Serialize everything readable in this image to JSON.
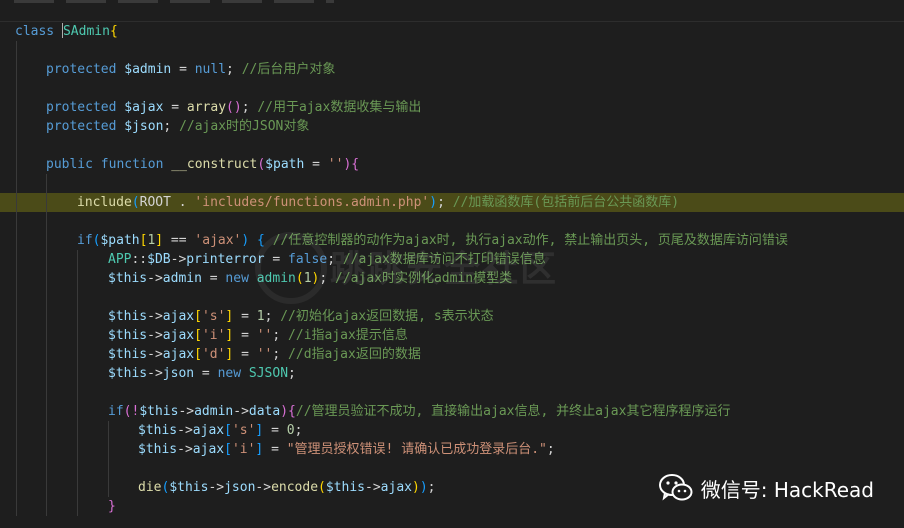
{
  "code": {
    "l1_class_kw": "class",
    "l1_class_name": "SAdmin",
    "l1_brace": "{",
    "l3_protected": "protected",
    "l3_var": "$admin",
    "l3_eq": " = ",
    "l3_null": "null",
    "l3_semi": ";",
    "l3_comment": "//后台用户对象",
    "l5_protected": "protected",
    "l5_var": "$ajax",
    "l5_eq": " = ",
    "l5_fn": "array",
    "l5_paren": "()",
    "l5_semi": ";",
    "l5_comment": "//用于ajax数据收集与输出",
    "l6_protected": "protected",
    "l6_var": "$json",
    "l6_semi": ";",
    "l6_comment": "//ajax时的JSON对象",
    "l8_public": "public",
    "l8_function": "function",
    "l8_name": "__construct",
    "l8_open": "(",
    "l8_var": "$path",
    "l8_eq": " = ",
    "l8_str": "''",
    "l8_close": ")",
    "l8_brace": "{",
    "l10_include": "include",
    "l10_open": "(",
    "l10_root": "ROOT",
    "l10_dot": " . ",
    "l10_str": "'includes/functions.admin.php'",
    "l10_close": ")",
    "l10_semi": ";",
    "l10_comment": "//加载函数库(包括前后台公共函数库)",
    "l12_if": "if",
    "l12_open": "(",
    "l12_var": "$path",
    "l12_idx_open": "[",
    "l12_idx": "1",
    "l12_idx_close": "]",
    "l12_eq": " == ",
    "l12_str": "'ajax'",
    "l12_close": ")",
    "l12_brace": "{",
    "l12_comment": "//任意控制器的动作为ajax时, 执行ajax动作, 禁止输出页头, 页尾及数据库访问错误",
    "l13_app": "APP",
    "l13_sep": "::",
    "l13_db": "$DB",
    "l13_arrow": "->",
    "l13_prop": "printerror",
    "l13_eq": " = ",
    "l13_false": "false",
    "l13_semi": ";",
    "l13_comment": "//ajax数据库访问不打印错误信息",
    "l14_this": "$this",
    "l14_arrow": "->",
    "l14_prop": "admin",
    "l14_eq": " = ",
    "l14_new": "new",
    "l14_cls": "admin",
    "l14_open": "(",
    "l14_num": "1",
    "l14_close": ")",
    "l14_semi": ";",
    "l14_comment": "//ajax时实例化admin模型类",
    "l16_this": "$this",
    "l16_arrow": "->",
    "l16_prop": "ajax",
    "l16_open": "[",
    "l16_key": "'s'",
    "l16_close": "]",
    "l16_eq": " = ",
    "l16_num": "1",
    "l16_semi": ";",
    "l16_comment": "//初始化ajax返回数据, s表示状态",
    "l17_this": "$this",
    "l17_arrow": "->",
    "l17_prop": "ajax",
    "l17_open": "[",
    "l17_key": "'i'",
    "l17_close": "]",
    "l17_eq": " = ",
    "l17_val": "''",
    "l17_semi": ";",
    "l17_comment": "//i指ajax提示信息",
    "l18_this": "$this",
    "l18_arrow": "->",
    "l18_prop": "ajax",
    "l18_open": "[",
    "l18_key": "'d'",
    "l18_close": "]",
    "l18_eq": " = ",
    "l18_val": "''",
    "l18_semi": ";",
    "l18_comment": "//d指ajax返回的数据",
    "l19_this": "$this",
    "l19_arrow": "->",
    "l19_prop": "json",
    "l19_eq": " = ",
    "l19_new": "new",
    "l19_cls": "SJSON",
    "l19_semi": ";",
    "l21_if": "if",
    "l21_open": "(!",
    "l21_this": "$this",
    "l21_arrow": "->",
    "l21_prop": "admin",
    "l21_arrow2": "->",
    "l21_prop2": "data",
    "l21_close": ")",
    "l21_brace": "{",
    "l21_comment": "//管理员验证不成功, 直接输出ajax信息, 并终止ajax其它程序程序运行",
    "l22_this": "$this",
    "l22_arrow": "->",
    "l22_prop": "ajax",
    "l22_open": "[",
    "l22_key": "'s'",
    "l22_close": "]",
    "l22_eq": " = ",
    "l22_num": "0",
    "l22_semi": ";",
    "l23_this": "$this",
    "l23_arrow": "->",
    "l23_prop": "ajax",
    "l23_open": "[",
    "l23_key": "'i'",
    "l23_close": "]",
    "l23_eq": " = ",
    "l23_str": "\"管理员授权错误! 请确认已成功登录后台.\"",
    "l23_semi": ";",
    "l25_die": "die",
    "l25_open": "(",
    "l25_this": "$this",
    "l25_arrow": "->",
    "l25_prop": "json",
    "l25_arrow2": "->",
    "l25_fn": "encode",
    "l25_open2": "(",
    "l25_this2": "$this",
    "l25_arrow3": "->",
    "l25_prop3": "ajax",
    "l25_close2": ")",
    "l25_close": ")",
    "l25_semi": ";",
    "l26_brace": "}"
  },
  "watermark": "跳跳安全社区",
  "wechat_label": "微信号: HackRead",
  "colors": {
    "background": "#1e1e1e",
    "highlight_line": "#4b4b18",
    "keyword": "#569cd6",
    "variable": "#9cdcfe",
    "function": "#dcdcaa",
    "string": "#ce9178",
    "comment": "#6a9955"
  },
  "icons": {
    "wechat": "wechat-icon"
  }
}
